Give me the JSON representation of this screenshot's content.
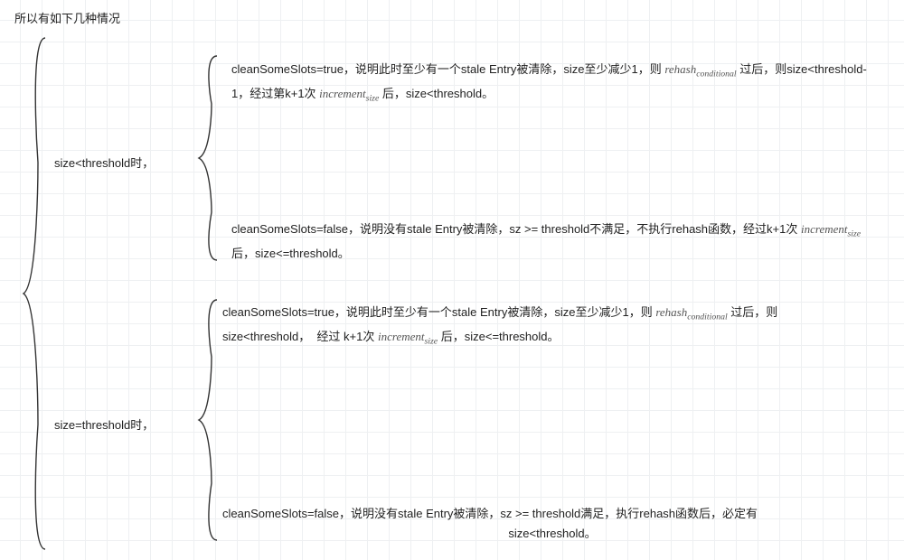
{
  "title": "所以有如下几种情况",
  "formulas": {
    "rehash": "rehash",
    "rehash_sub": "conditional",
    "increment": "increment",
    "increment_sub": "size"
  },
  "outer": {
    "case1": {
      "label": "size<threshold时，",
      "sub1": {
        "prefix": "cleanSomeSlots=true，说明此时至少有一个stale Entry被清除，size至少减少1，则 ",
        "mid": " 过后，则size<threshold-1，经过第k+1次 ",
        "suffix": " 后，size<threshold。"
      },
      "sub2": {
        "prefix": "cleanSomeSlots=false，说明没有stale Entry被清除，sz >= threshold不满足，不执行rehash函数，经过k+1次 ",
        "suffix": "后，size<=threshold。"
      }
    },
    "case2": {
      "label": "size=threshold时，",
      "sub1": {
        "prefix": "cleanSomeSlots=true，说明此时至少有一个stale Entry被清除，size至少减少1，则",
        "mid": " 过后，则size<threshold，  经过 k+1次",
        "suffix": " 后，size<=threshold。"
      },
      "sub2": {
        "line1": "cleanSomeSlots=false，说明没有stale Entry被清除，sz >= threshold满足，执行rehash函数后，必定有",
        "line2": "size<threshold。"
      }
    }
  }
}
